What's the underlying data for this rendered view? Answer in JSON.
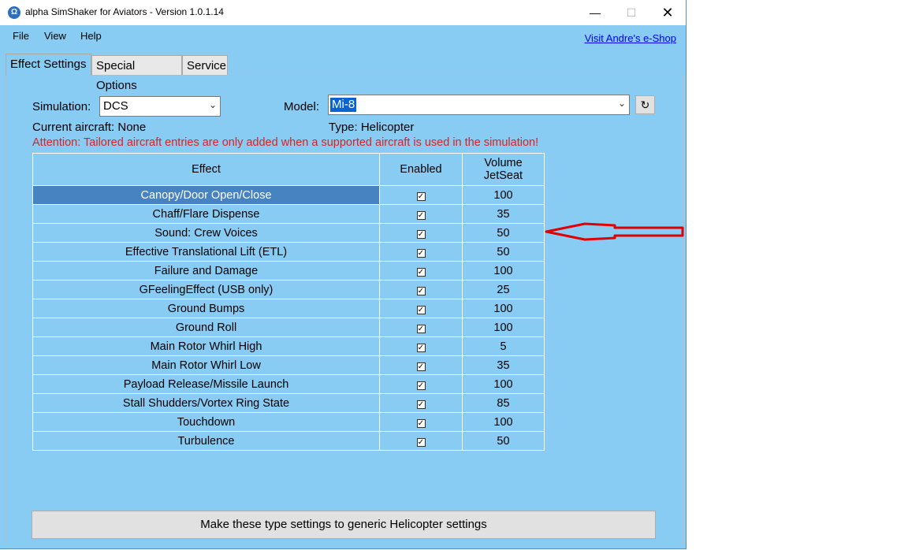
{
  "window": {
    "title": "alpha SimShaker for Aviators  - Version 1.0.1.14",
    "app_icon_glyph": "Ω"
  },
  "menu": {
    "items": [
      "File",
      "View",
      "Help"
    ],
    "shop_link": "Visit Andre's e-Shop"
  },
  "tabs": [
    {
      "label": "Effect Settings",
      "active": true
    },
    {
      "label": "Special Options",
      "active": false
    },
    {
      "label": "Service",
      "active": false
    }
  ],
  "form": {
    "simulation_label": "Simulation:",
    "simulation_value": "DCS",
    "model_label": "Model:",
    "model_value": "Mi-8",
    "refresh_glyph": "↻",
    "current_aircraft": "Current aircraft: None",
    "type": "Type: Helicopter",
    "attention": "Attention: Tailored aircraft entries are only added when a supported aircraft is used in the simulation!"
  },
  "table": {
    "headers": [
      "Effect",
      "Enabled",
      "Volume\nJetSeat"
    ],
    "rows": [
      {
        "effect": "Canopy/Door Open/Close",
        "enabled": true,
        "volume": "100",
        "selected": true
      },
      {
        "effect": "Chaff/Flare Dispense",
        "enabled": true,
        "volume": "35"
      },
      {
        "effect": "Sound: Crew Voices",
        "enabled": true,
        "volume": "50"
      },
      {
        "effect": "Effective Translational Lift (ETL)",
        "enabled": true,
        "volume": "50"
      },
      {
        "effect": "Failure and Damage",
        "enabled": true,
        "volume": "100"
      },
      {
        "effect": "GFeelingEffect (USB only)",
        "enabled": true,
        "volume": "25"
      },
      {
        "effect": "Ground Bumps",
        "enabled": true,
        "volume": "100"
      },
      {
        "effect": "Ground Roll",
        "enabled": true,
        "volume": "100"
      },
      {
        "effect": "Main Rotor Whirl High",
        "enabled": true,
        "volume": "5"
      },
      {
        "effect": "Main Rotor Whirl Low",
        "enabled": true,
        "volume": "35"
      },
      {
        "effect": "Payload Release/Missile Launch",
        "enabled": true,
        "volume": "100"
      },
      {
        "effect": "Stall Shudders/Vortex Ring State",
        "enabled": true,
        "volume": "85"
      },
      {
        "effect": "Touchdown",
        "enabled": true,
        "volume": "100"
      },
      {
        "effect": "Turbulence",
        "enabled": true,
        "volume": "50"
      }
    ]
  },
  "bottom_button": "Make these type settings to generic Helicopter settings",
  "colors": {
    "window_bg": "#88ccf4",
    "selection": "#4683c0",
    "warning": "#e02020",
    "annotation_arrow": "#e00000"
  }
}
